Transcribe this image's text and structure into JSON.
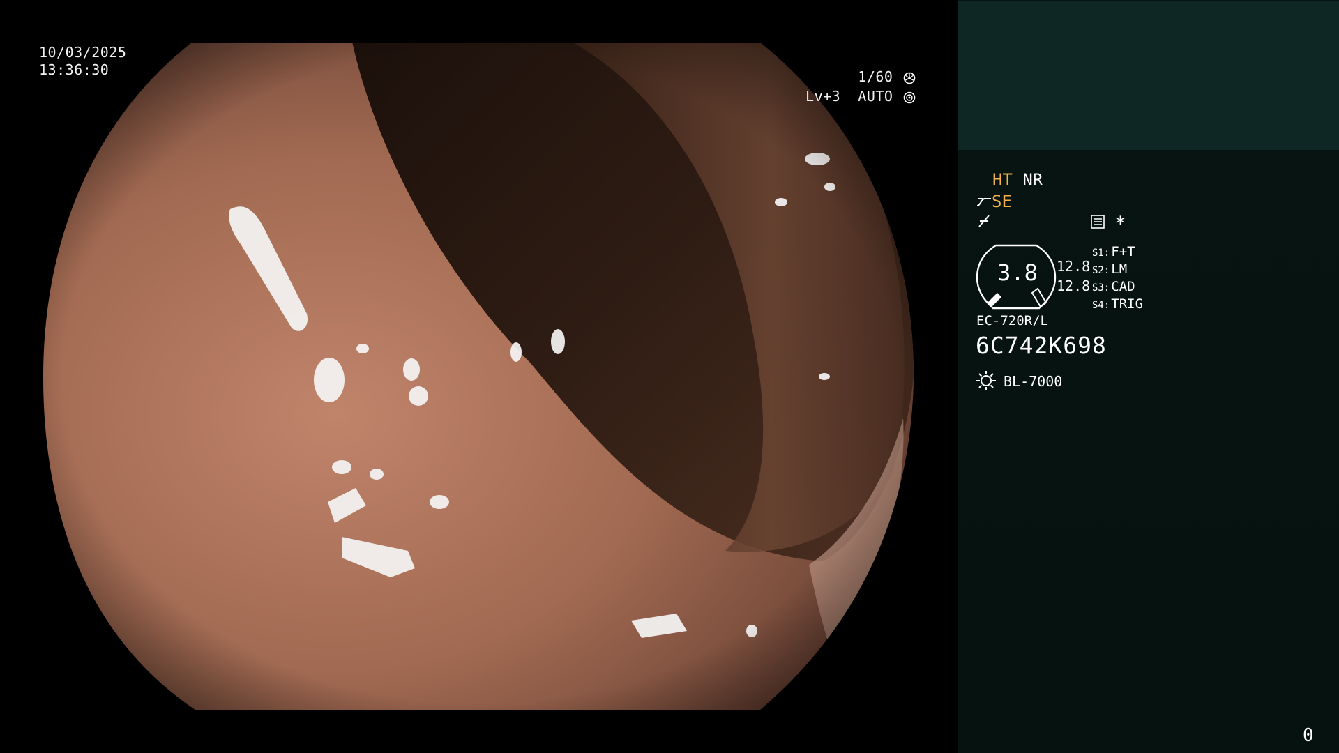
{
  "overlay": {
    "date": "10/03/2025",
    "time": "13:36:30",
    "shutter": "1/60",
    "shutter_icon": "aperture-icon",
    "exposure": "Lv+3  AUTO",
    "exposure_icon": "lens-icon"
  },
  "panel": {
    "mode_primary": "HT",
    "mode_secondary": "NR",
    "enhancement": "SE",
    "enhancement_icon": "curve-icon",
    "pen_icon": "pen-icon",
    "list_icon": "menu-list-icon",
    "star": "*",
    "gauge_value": "3.8",
    "readout_top": "12.8",
    "readout_bottom": "12.8",
    "switches": [
      {
        "key": "S1:",
        "label": "F+T"
      },
      {
        "key": "S2:",
        "label": "LM"
      },
      {
        "key": "S3:",
        "label": "CAD"
      },
      {
        "key": "S4:",
        "label": "TRIG"
      }
    ],
    "scope_model": "EC-720R/L",
    "scope_serial": "6C742K698",
    "light_icon": "sun-icon",
    "light_source": "BL-7000",
    "counter": "0"
  },
  "colors": {
    "panel_top": "#0e2724",
    "panel_bg": "#061210",
    "accent_amber": "#f3b24c",
    "text": "#ffffff"
  }
}
